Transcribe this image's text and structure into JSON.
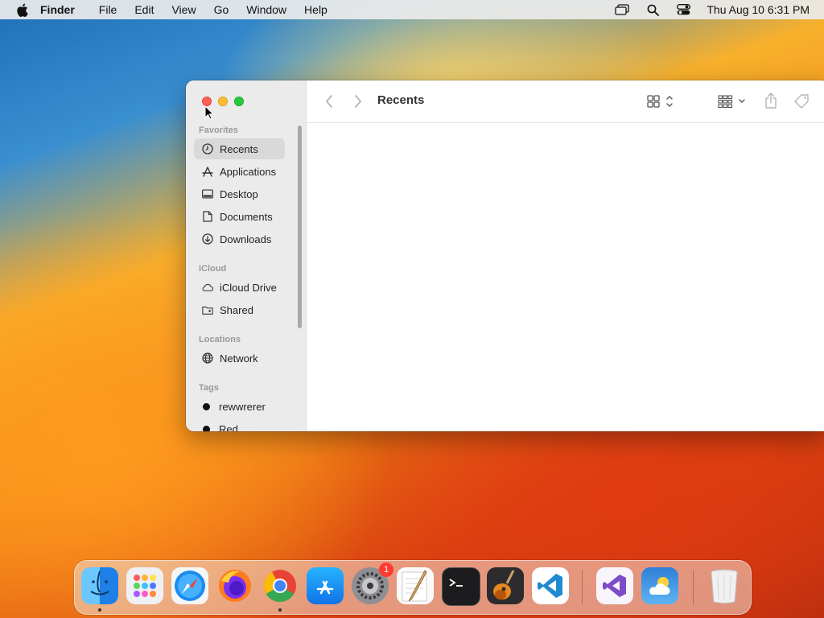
{
  "menubar": {
    "app_name": "Finder",
    "menus": [
      "File",
      "Edit",
      "View",
      "Go",
      "Window",
      "Help"
    ],
    "clock": "Thu Aug 10  6:31 PM",
    "status_icons": [
      "screen-mirroring-icon",
      "search-icon",
      "control-center-icon"
    ]
  },
  "window": {
    "title": "Recents",
    "sidebar": {
      "sections": [
        {
          "title": "Favorites",
          "items": [
            {
              "label": "Recents",
              "icon": "clock-icon",
              "selected": true
            },
            {
              "label": "Applications",
              "icon": "applications-icon"
            },
            {
              "label": "Desktop",
              "icon": "desktop-icon"
            },
            {
              "label": "Documents",
              "icon": "document-icon"
            },
            {
              "label": "Downloads",
              "icon": "download-icon"
            }
          ]
        },
        {
          "title": "iCloud",
          "items": [
            {
              "label": "iCloud Drive",
              "icon": "cloud-icon"
            },
            {
              "label": "Shared",
              "icon": "shared-folder-icon"
            }
          ]
        },
        {
          "title": "Locations",
          "items": [
            {
              "label": "Network",
              "icon": "globe-icon"
            }
          ]
        },
        {
          "title": "Tags",
          "items": [
            {
              "label": "rewwrerer",
              "icon": "tag-dot",
              "color": "#111111"
            },
            {
              "label": "Red",
              "icon": "tag-dot",
              "color": "#111111"
            }
          ]
        }
      ]
    },
    "toolbar": [
      "back-icon",
      "forward-icon",
      "icon-view-icon",
      "group-icon",
      "share-icon",
      "tag-icon"
    ]
  },
  "dock": {
    "apps": [
      "Finder",
      "Launchpad",
      "Safari",
      "Firefox",
      "Google Chrome",
      "App Store",
      "System Settings",
      "TextEdit",
      "Terminal",
      "GarageBand",
      "Visual Studio Code",
      "Visual Studio",
      "Weather",
      "Trash"
    ],
    "badge": "1"
  }
}
